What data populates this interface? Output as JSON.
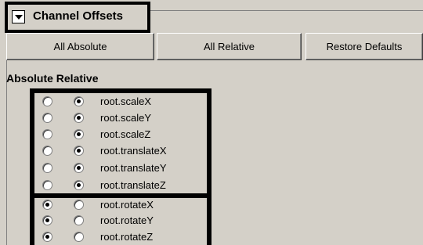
{
  "header": {
    "title": "Channel Offsets"
  },
  "buttons": {
    "all_absolute": "All Absolute",
    "all_relative": "All Relative",
    "restore_defaults": "Restore Defaults"
  },
  "columns": {
    "labels": "Absolute Relative"
  },
  "channels": [
    {
      "label": "root.scaleX",
      "mode": "relative"
    },
    {
      "label": "root.scaleY",
      "mode": "relative"
    },
    {
      "label": "root.scaleZ",
      "mode": "relative"
    },
    {
      "label": "root.translateX",
      "mode": "relative"
    },
    {
      "label": "root.translateY",
      "mode": "relative"
    },
    {
      "label": "root.translateZ",
      "mode": "relative"
    },
    {
      "label": "root.rotateX",
      "mode": "absolute"
    },
    {
      "label": "root.rotateY",
      "mode": "absolute"
    },
    {
      "label": "root.rotateZ",
      "mode": "absolute"
    }
  ]
}
